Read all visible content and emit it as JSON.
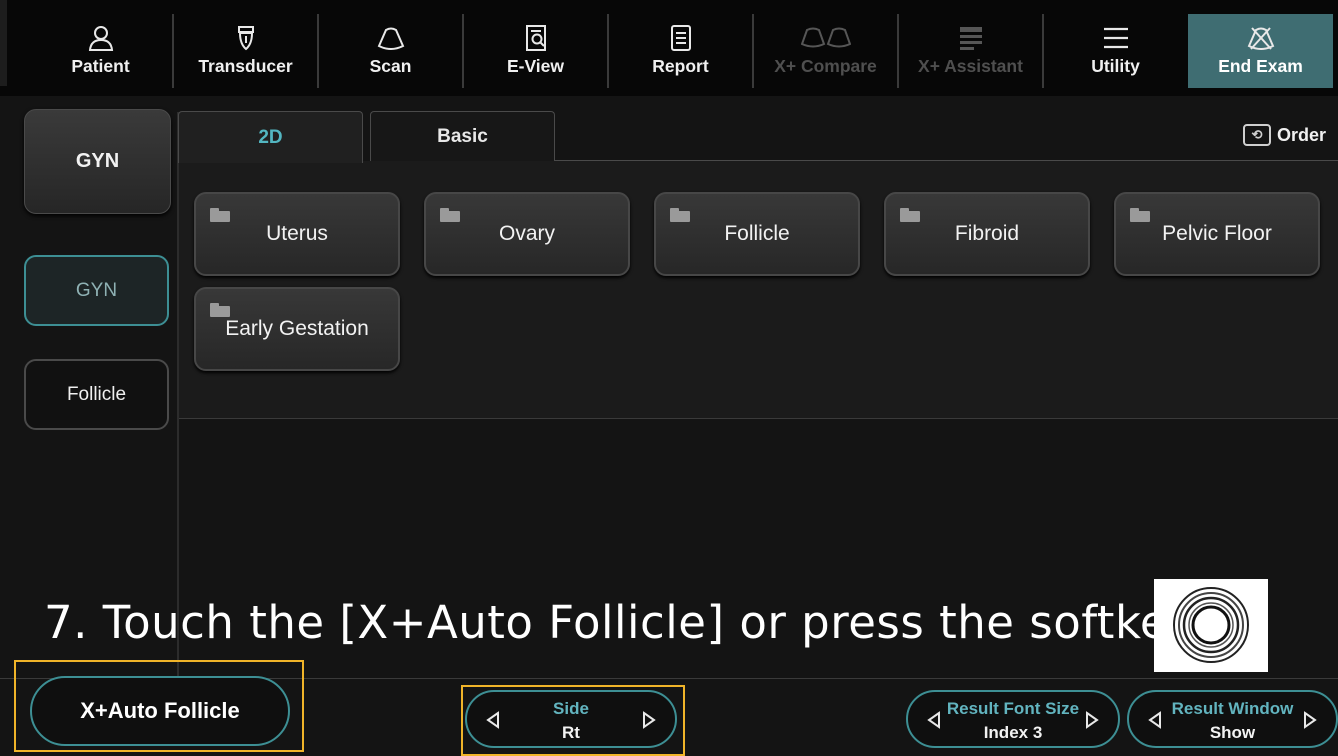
{
  "toolbar": {
    "items": [
      {
        "label": "Patient",
        "icon": "person-icon",
        "enabled": true
      },
      {
        "label": "Transducer",
        "icon": "transducer-icon",
        "enabled": true
      },
      {
        "label": "Scan",
        "icon": "scan-sector-icon",
        "enabled": true
      },
      {
        "label": "E-View",
        "icon": "document-search-icon",
        "enabled": true
      },
      {
        "label": "Report",
        "icon": "report-icon",
        "enabled": true
      },
      {
        "label": "X+ Compare",
        "icon": "compare-icon",
        "enabled": false
      },
      {
        "label": "X+ Assistant",
        "icon": "assistant-icon",
        "enabled": false
      },
      {
        "label": "Utility",
        "icon": "menu-icon",
        "enabled": true
      },
      {
        "label": "End Exam",
        "icon": "end-exam-icon",
        "enabled": true
      }
    ]
  },
  "presets": {
    "main": "GYN",
    "sub_active": "GYN",
    "sub_other": "Follicle"
  },
  "tabs": {
    "active": "2D",
    "inactive": "Basic",
    "order_label": "Order"
  },
  "folders": [
    "Uterus",
    "Ovary",
    "Follicle",
    "Fibroid",
    "Pelvic Floor",
    "Early Gestation"
  ],
  "instruction": {
    "text": "7. Touch the [X+Auto Follicle] or press the softkey"
  },
  "softkeys": {
    "main": "X+Auto Follicle",
    "side": {
      "title": "Side",
      "value": "Rt"
    },
    "result_font_size": {
      "title": "Result Font Size",
      "value": "Index 3"
    },
    "result_window": {
      "title": "Result Window",
      "value": "Show"
    }
  },
  "colors": {
    "accent_teal": "#3d8f94",
    "tab_active_text": "#53b6c1",
    "highlight_box": "#f0b429",
    "end_exam_bg": "#3f6d72"
  }
}
